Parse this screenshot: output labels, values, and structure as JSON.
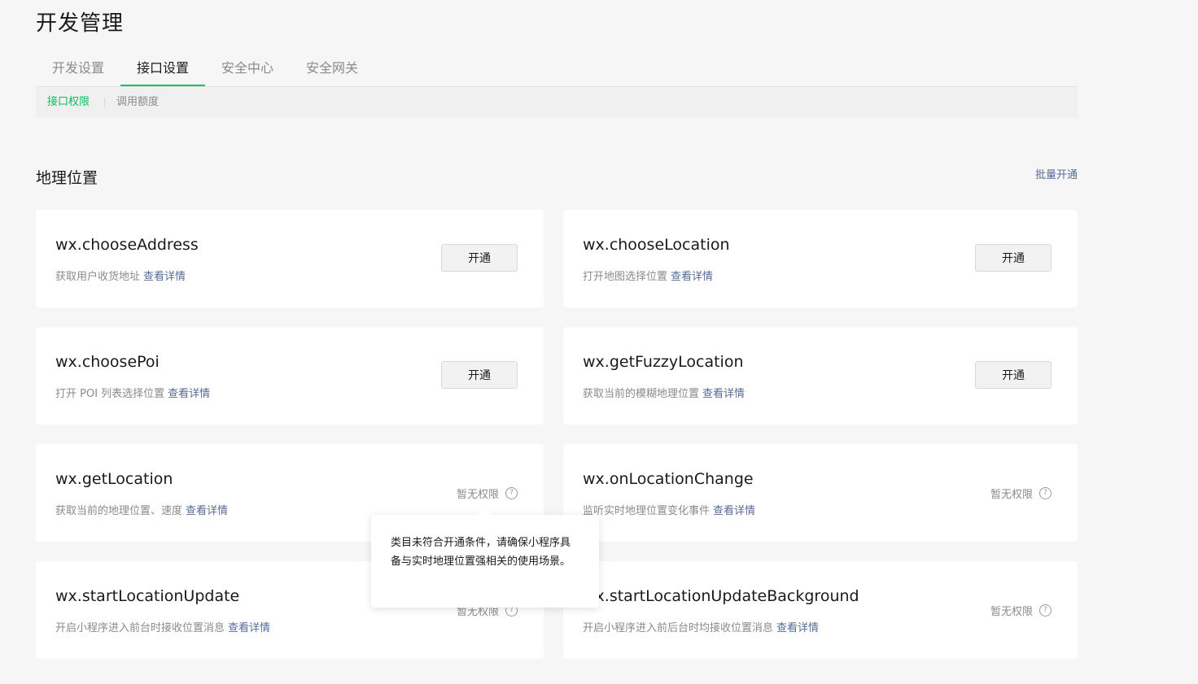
{
  "page": {
    "title": "开发管理"
  },
  "tabs": [
    {
      "label": "开发设置"
    },
    {
      "label": "接口设置"
    },
    {
      "label": "安全中心"
    },
    {
      "label": "安全网关"
    }
  ],
  "subnav": [
    {
      "label": "接口权限"
    },
    {
      "label": "调用额度"
    }
  ],
  "section": {
    "title": "地理位置",
    "batch_label": "批量开通"
  },
  "cards": [
    {
      "name": "wx.chooseAddress",
      "desc": "获取用户收货地址",
      "link": "查看详情",
      "action": "开通"
    },
    {
      "name": "wx.chooseLocation",
      "desc": "打开地图选择位置",
      "link": "查看详情",
      "action": "开通"
    },
    {
      "name": "wx.choosePoi",
      "desc": "打开 POI 列表选择位置",
      "link": "查看详情",
      "action": "开通"
    },
    {
      "name": "wx.getFuzzyLocation",
      "desc": "获取当前的模糊地理位置",
      "link": "查看详情",
      "action": "开通"
    },
    {
      "name": "wx.getLocation",
      "desc": "获取当前的地理位置、速度",
      "link": "查看详情",
      "status": "暂无权限"
    },
    {
      "name": "wx.onLocationChange",
      "desc": "监听实时地理位置变化事件",
      "link": "查看详情",
      "status": "暂无权限"
    },
    {
      "name": "wx.startLocationUpdate",
      "desc": "开启小程序进入前台时接收位置消息",
      "link": "查看详情",
      "status": "暂无权限"
    },
    {
      "name": "wx.startLocationUpdateBackground",
      "desc": "开启小程序进入前后台时均接收位置消息",
      "link": "查看详情",
      "status": "暂无权限"
    }
  ],
  "tooltip": {
    "text": "类目未符合开通条件，请确保小程序具备与实时地理位置强相关的使用场景。"
  },
  "icons": {
    "help": "question-circle-icon"
  },
  "colors": {
    "accent": "#07c160",
    "link": "#576b95"
  }
}
